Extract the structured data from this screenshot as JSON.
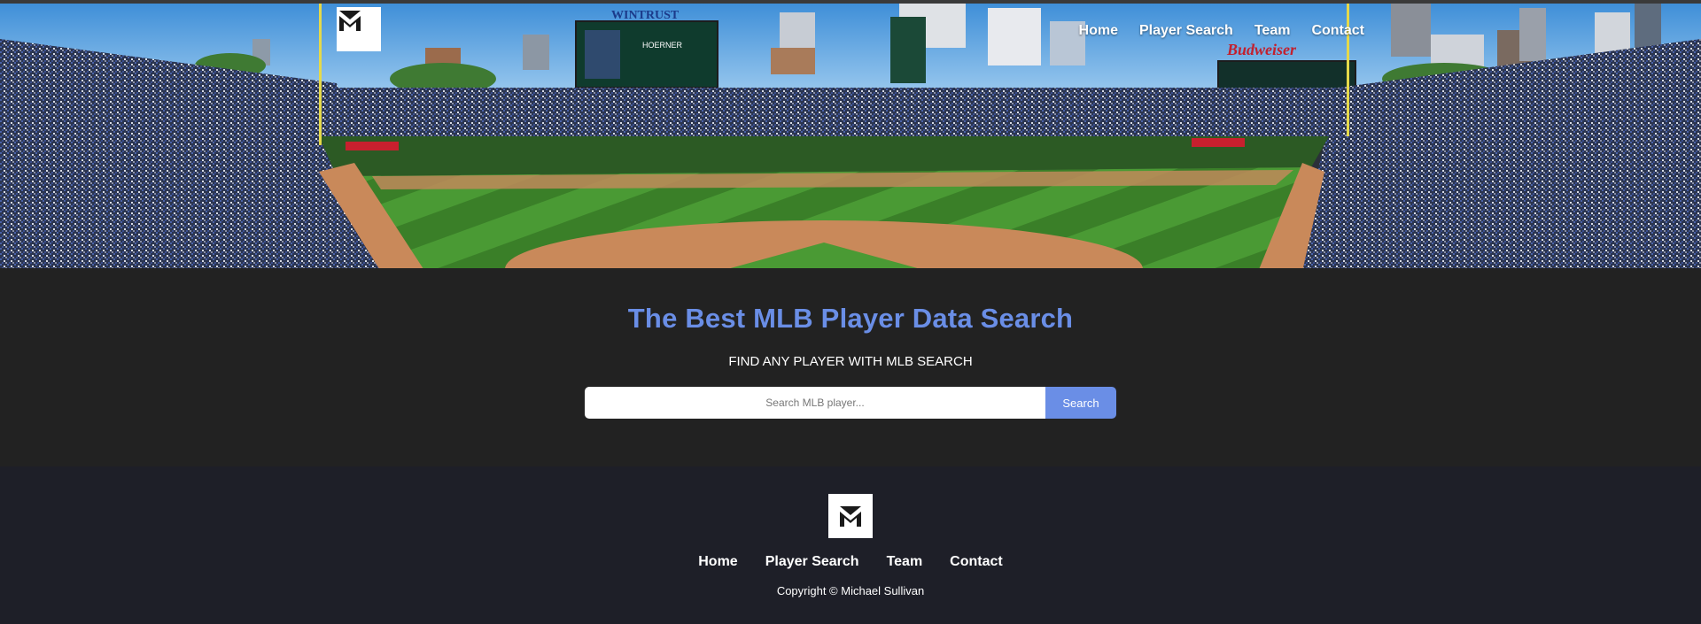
{
  "brand": {
    "logo_icon": "mlb-m-logo-icon",
    "accent_color": "#6a8ee6"
  },
  "nav": {
    "items": [
      {
        "label": "Home"
      },
      {
        "label": "Player Search"
      },
      {
        "label": "Team"
      },
      {
        "label": "Contact"
      }
    ]
  },
  "hero": {
    "scoreboard_top": "WINTRUST",
    "scoreboard_name_1": "HOERNER",
    "sign_text": "Budweiser"
  },
  "search": {
    "title": "The Best MLB Player Data Search",
    "subtitle": "FIND ANY PLAYER WITH MLB SEARCH",
    "placeholder": "Search MLB player...",
    "button_label": "Search"
  },
  "footer": {
    "nav": [
      {
        "label": "Home"
      },
      {
        "label": "Player Search"
      },
      {
        "label": "Team"
      },
      {
        "label": "Contact"
      }
    ],
    "copyright": "Copyright © Michael Sullivan"
  }
}
